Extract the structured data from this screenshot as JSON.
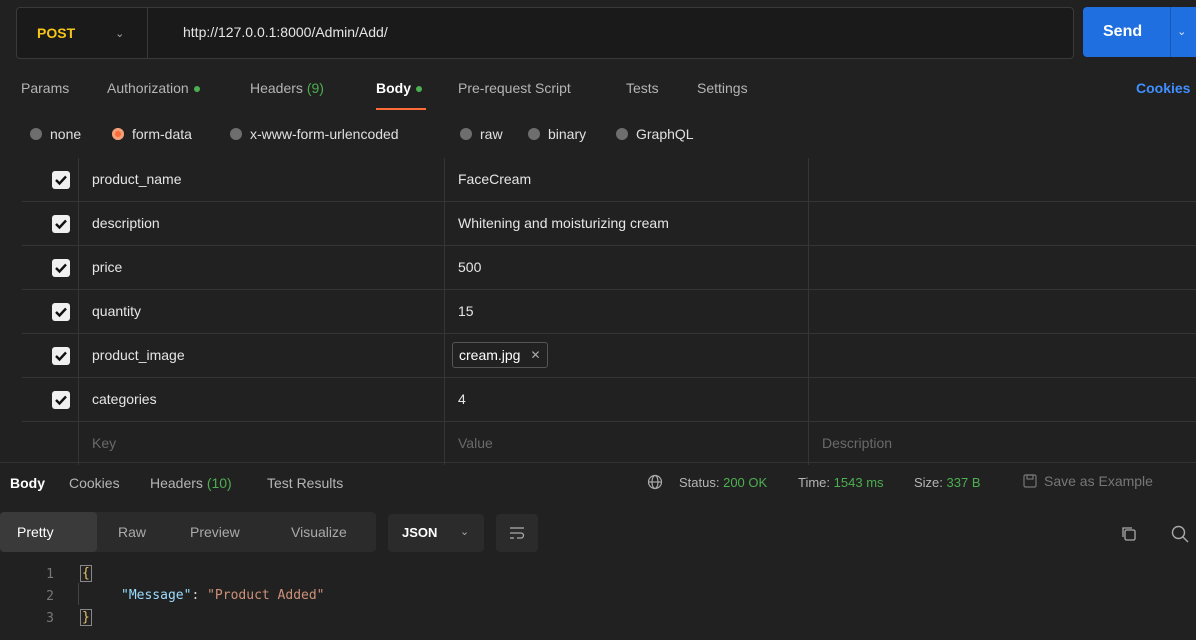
{
  "request": {
    "method": "POST",
    "url": "http://127.0.0.1:8000/Admin/Add/",
    "send_label": "Send"
  },
  "tabs": [
    {
      "label": "Params"
    },
    {
      "label": "Authorization"
    },
    {
      "label": "Headers",
      "count": "(9)"
    },
    {
      "label": "Body"
    },
    {
      "label": "Pre-request Script"
    },
    {
      "label": "Tests"
    },
    {
      "label": "Settings"
    }
  ],
  "cookies_link": "Cookies",
  "body_types": [
    "none",
    "form-data",
    "x-www-form-urlencoded",
    "raw",
    "binary",
    "GraphQL"
  ],
  "body_type_selected": "form-data",
  "form_rows": [
    {
      "key": "product_name",
      "value": "FaceCream",
      "checked": true
    },
    {
      "key": "description",
      "value": "Whitening and moisturizing cream",
      "checked": true
    },
    {
      "key": "price",
      "value": "500",
      "checked": true
    },
    {
      "key": "quantity",
      "value": "15",
      "checked": true
    },
    {
      "key": "product_image",
      "value": "cream.jpg",
      "checked": true,
      "type": "file"
    },
    {
      "key": "categories",
      "value": "4",
      "checked": true
    }
  ],
  "placeholders": {
    "key": "Key",
    "value": "Value",
    "description": "Description"
  },
  "response": {
    "tabs": [
      {
        "label": "Body"
      },
      {
        "label": "Cookies"
      },
      {
        "label": "Headers",
        "count": "(10)"
      },
      {
        "label": "Test Results"
      }
    ],
    "status_label": "Status:",
    "status_value": "200 OK",
    "time_label": "Time:",
    "time_value": "1543 ms",
    "size_label": "Size:",
    "size_value": "337 B",
    "save_example": "Save as Example",
    "views": [
      "Pretty",
      "Raw",
      "Preview",
      "Visualize"
    ],
    "format": "JSON",
    "code_lines": [
      "1",
      "2",
      "3"
    ],
    "json_key": "\"Message\"",
    "json_colon": ": ",
    "json_value": "\"Product Added\""
  },
  "colors": {
    "accent": "#ff6c37",
    "send": "#1f6fe0",
    "success": "#4caf50",
    "method": "#f5c518"
  }
}
